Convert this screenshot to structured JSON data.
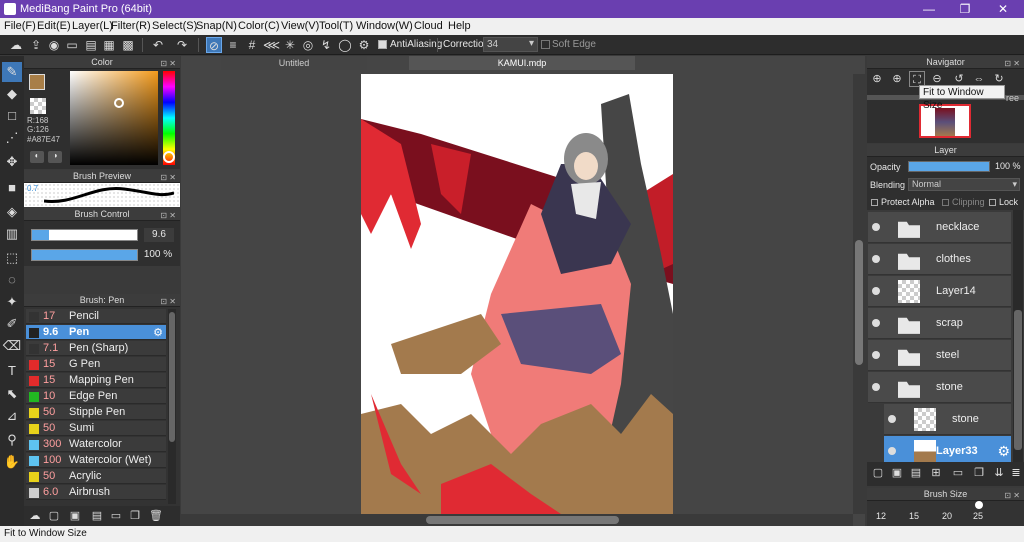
{
  "window": {
    "title": "MediBang Paint Pro (64bit)",
    "min": "—",
    "restore": "❐",
    "close": "✕"
  },
  "menu": [
    "File(F)",
    "Edit(E)",
    "Layer(L)",
    "Filter(R)",
    "Select(S)",
    "Snap(N)",
    "Color(C)",
    "View(V)",
    "Tool(T)",
    "Window(W)",
    "Cloud",
    "Help"
  ],
  "toolbar": {
    "antialias_label": "AntiAliasing",
    "correction_label": "Correction",
    "correction_value": "34",
    "soft_edge_label": "Soft Edge"
  },
  "color_panel": {
    "title": "Color",
    "r": "R:168",
    "g": "G:126",
    "hex": "#A87E47",
    "primary_color": "#a87e47",
    "secondary_color": "#6a1f1f"
  },
  "brush_preview": {
    "title": "Brush Preview",
    "value": "0.7"
  },
  "brush_control": {
    "title": "Brush Control",
    "size": "9.6",
    "opacity": "100 %"
  },
  "brush_panel": {
    "title": "Brush: Pen",
    "items": [
      {
        "size": "17",
        "name": "Pencil",
        "color": "#333333"
      },
      {
        "size": "9.6",
        "name": "Pen",
        "color": "#222222"
      },
      {
        "size": "7.1",
        "name": "Pen (Sharp)",
        "color": "#333333"
      },
      {
        "size": "15",
        "name": "G Pen",
        "color": "#e22b2b"
      },
      {
        "size": "15",
        "name": "Mapping Pen",
        "color": "#e22b2b"
      },
      {
        "size": "10",
        "name": "Edge Pen",
        "color": "#22b822"
      },
      {
        "size": "50",
        "name": "Stipple Pen",
        "color": "#e8d21a"
      },
      {
        "size": "50",
        "name": "Sumi",
        "color": "#e8d21a"
      },
      {
        "size": "300",
        "name": "Watercolor",
        "color": "#5ec3f0"
      },
      {
        "size": "100",
        "name": "Watercolor (Wet)",
        "color": "#5ec3f0"
      },
      {
        "size": "50",
        "name": "Acrylic",
        "color": "#e8d21a"
      },
      {
        "size": "6.0",
        "name": "Airbrush",
        "color": "#cccccc"
      }
    ]
  },
  "tabs": {
    "untitled": "Untitled",
    "active": "KAMUI.mdp"
  },
  "navigator": {
    "title": "Navigator",
    "tooltip": "Fit to Window Size",
    "partial": "ree"
  },
  "layer_panel": {
    "title": "Layer",
    "opacity_label": "Opacity",
    "opacity_value": "100 %",
    "opacity_fraction": 1.0,
    "blending_label": "Blending",
    "blending_value": "Normal",
    "protect_alpha": "Protect Alpha",
    "clipping": "Clipping",
    "lock": "Lock",
    "layers": [
      {
        "name": "necklace",
        "type": "folder"
      },
      {
        "name": "clothes",
        "type": "folder"
      },
      {
        "name": "Layer14",
        "type": "layer"
      },
      {
        "name": "scrap",
        "type": "folder"
      },
      {
        "name": "steel",
        "type": "folder"
      },
      {
        "name": "stone",
        "type": "folder-open"
      },
      {
        "name": "stone",
        "type": "layer"
      },
      {
        "name": "Layer33",
        "type": "layer"
      }
    ]
  },
  "brush_size": {
    "title": "Brush Size",
    "values": [
      "12",
      "15",
      "20",
      "25"
    ]
  },
  "status": {
    "text": "Fit to Window Size"
  }
}
